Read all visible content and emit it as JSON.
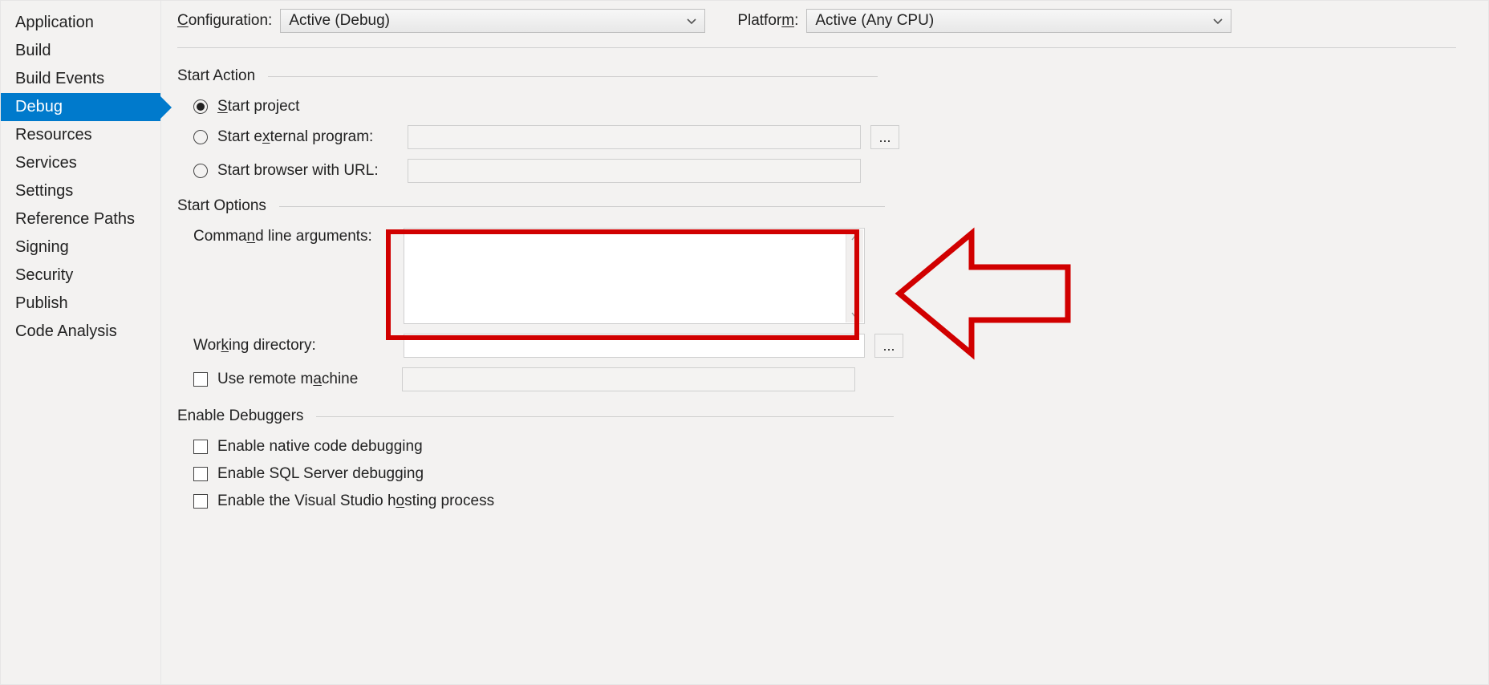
{
  "sidebar": {
    "items": [
      {
        "label": "Application",
        "selected": false
      },
      {
        "label": "Build",
        "selected": false
      },
      {
        "label": "Build Events",
        "selected": false
      },
      {
        "label": "Debug",
        "selected": true
      },
      {
        "label": "Resources",
        "selected": false
      },
      {
        "label": "Services",
        "selected": false
      },
      {
        "label": "Settings",
        "selected": false
      },
      {
        "label": "Reference Paths",
        "selected": false
      },
      {
        "label": "Signing",
        "selected": false
      },
      {
        "label": "Security",
        "selected": false
      },
      {
        "label": "Publish",
        "selected": false
      },
      {
        "label": "Code Analysis",
        "selected": false
      }
    ]
  },
  "config_bar": {
    "configuration_label": "onfiguration:",
    "configuration_accel": "C",
    "configuration_value": "Active (Debug)",
    "platform_label_a": "Platfor",
    "platform_accel": "m",
    "platform_label_b": ":",
    "platform_value": "Active (Any CPU)"
  },
  "start_action": {
    "heading": "Start Action",
    "start_project_a": "tart project",
    "start_project_accel": "S",
    "start_external_a": "Start e",
    "start_external_accel": "x",
    "start_external_b": "ternal program:",
    "start_browser": "Start browser with URL:"
  },
  "start_options": {
    "heading": "Start Options",
    "cmdline_a": "Comma",
    "cmdline_accel": "n",
    "cmdline_b": "d line arguments:",
    "cmdline_value": "",
    "workdir_a": "Wor",
    "workdir_accel": "k",
    "workdir_b": "ing directory:",
    "workdir_value": "",
    "remote_a": "Use remote m",
    "remote_accel": "a",
    "remote_b": "chine",
    "remote_value": ""
  },
  "enable_debuggers": {
    "heading": "Enable Debuggers",
    "native": "Enable native code debugging",
    "sql": "Enable SQL Server debugging",
    "hosting_a": "Enable the Visual Studio h",
    "hosting_accel": "o",
    "hosting_b": "sting process"
  },
  "browse": "...",
  "annotation": {
    "highlight_target": "command-line-arguments-input"
  }
}
